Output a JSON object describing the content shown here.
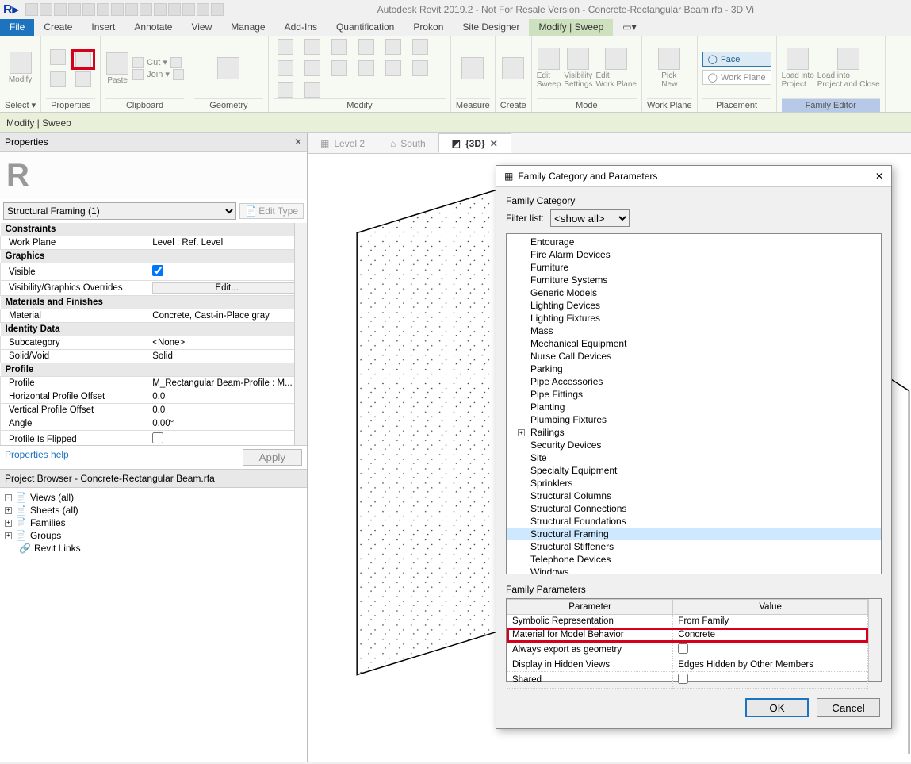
{
  "app": {
    "title": "Autodesk Revit 2019.2 - Not For Resale Version - Concrete-Rectangular Beam.rfa - 3D Vi"
  },
  "menubar": {
    "tabs": [
      "File",
      "Create",
      "Insert",
      "Annotate",
      "View",
      "Manage",
      "Add-Ins",
      "Quantification",
      "Prokon",
      "Site Designer",
      "Modify | Sweep"
    ],
    "active_index": 10
  },
  "ribbon": {
    "panels": {
      "select": {
        "label": "Select ▾",
        "modify": "Modify"
      },
      "properties": {
        "label": "Properties"
      },
      "clipboard": {
        "label": "Clipboard",
        "paste": "Paste",
        "cut": "Cut ▾",
        "join": "Join ▾"
      },
      "geometry": {
        "label": "Geometry"
      },
      "modify": {
        "label": "Modify"
      },
      "measure": {
        "label": "Measure"
      },
      "create": {
        "label": "Create"
      },
      "mode": {
        "label": "Mode",
        "edit_sweep": "Edit\nSweep",
        "visibility": "Visibility\nSettings",
        "edit_workplane": "Edit\nWork Plane"
      },
      "workplane": {
        "label": "Work Plane",
        "pick_new": "Pick\nNew"
      },
      "placement": {
        "label": "Placement",
        "face": "Face",
        "work_plane": "Work Plane"
      },
      "family_editor": {
        "label": "Family Editor",
        "load_project": "Load into\nProject",
        "load_close": "Load into\nProject and Close"
      }
    }
  },
  "sub_ribbon": {
    "text": "Modify | Sweep"
  },
  "properties": {
    "header": "Properties",
    "type_selector": "Structural Framing (1)",
    "edit_type": "Edit Type",
    "groups": [
      {
        "name": "Constraints",
        "rows": [
          {
            "label": "Work Plane",
            "value": "Level : Ref. Level"
          }
        ]
      },
      {
        "name": "Graphics",
        "rows": [
          {
            "label": "Visible",
            "value": "__check__",
            "checked": true
          },
          {
            "label": "Visibility/Graphics Overrides",
            "value": "__button__",
            "btn": "Edit..."
          }
        ]
      },
      {
        "name": "Materials and Finishes",
        "rows": [
          {
            "label": "Material",
            "value": "Concrete, Cast-in-Place gray"
          }
        ]
      },
      {
        "name": "Identity Data",
        "rows": [
          {
            "label": "Subcategory",
            "value": "<None>"
          },
          {
            "label": "Solid/Void",
            "value": "Solid"
          }
        ]
      },
      {
        "name": "Profile",
        "rows": [
          {
            "label": "Profile",
            "value": "M_Rectangular Beam-Profile : M..."
          },
          {
            "label": "Horizontal Profile Offset",
            "value": "0.0"
          },
          {
            "label": "Vertical Profile Offset",
            "value": "0.0"
          },
          {
            "label": "Angle",
            "value": "0.00°"
          },
          {
            "label": "Profile Is Flipped",
            "value": "__check__",
            "checked": false
          }
        ]
      }
    ],
    "help": "Properties help",
    "apply": "Apply"
  },
  "browser": {
    "title": "Project Browser - Concrete-Rectangular Beam.rfa",
    "nodes": [
      {
        "expander": "-",
        "icon": "views",
        "label": "Views (all)"
      },
      {
        "expander": "+",
        "icon": "sheets",
        "label": "Sheets (all)"
      },
      {
        "expander": "+",
        "icon": "families",
        "label": "Families"
      },
      {
        "expander": "+",
        "icon": "groups",
        "label": "Groups"
      },
      {
        "expander": "",
        "icon": "links",
        "label": "Revit Links"
      }
    ]
  },
  "view_tabs": {
    "tabs": [
      {
        "label": "Level 2",
        "active": false
      },
      {
        "label": "South",
        "active": false
      },
      {
        "label": "{3D}",
        "active": true
      }
    ]
  },
  "dialog": {
    "title": "Family Category and Parameters",
    "cat_section": "Family Category",
    "filter_label": "Filter list:",
    "filter_value": "<show all>",
    "categories": [
      "Entourage",
      "Fire Alarm Devices",
      "Furniture",
      "Furniture Systems",
      "Generic Models",
      "Lighting Devices",
      "Lighting Fixtures",
      "Mass",
      "Mechanical Equipment",
      "Nurse Call Devices",
      "Parking",
      "Pipe Accessories",
      "Pipe Fittings",
      "Planting",
      "Plumbing Fixtures",
      "Railings",
      "Security Devices",
      "Site",
      "Specialty Equipment",
      "Sprinklers",
      "Structural Columns",
      "Structural Connections",
      "Structural Foundations",
      "Structural Framing",
      "Structural Stiffeners",
      "Telephone Devices",
      "Windows"
    ],
    "selected_category": "Structural Framing",
    "expandable_category": "Railings",
    "param_section": "Family Parameters",
    "param_headers": [
      "Parameter",
      "Value"
    ],
    "param_rows": [
      {
        "name": "Symbolic Representation",
        "value": "From Family"
      },
      {
        "name": "Material for Model Behavior",
        "value": "Concrete",
        "highlight": true
      },
      {
        "name": "Always export as geometry",
        "value": "__check__",
        "checked": false
      },
      {
        "name": "Display in Hidden Views",
        "value": "Edges Hidden by Other Members"
      },
      {
        "name": "Shared",
        "value": "__check__",
        "checked": false
      }
    ],
    "ok": "OK",
    "cancel": "Cancel"
  }
}
